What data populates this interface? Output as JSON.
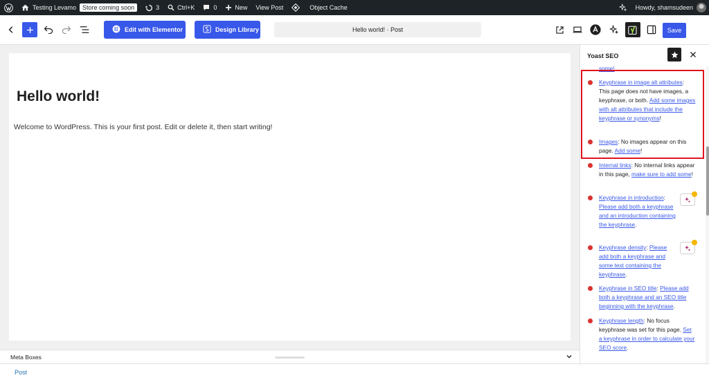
{
  "admin_bar": {
    "site_name": "Testing Levamo",
    "store_badge": "Store coming soon",
    "updates_count": "3",
    "shortcut": "Ctrl+K",
    "comments_count": "0",
    "new_label": "New",
    "view_post": "View Post",
    "object_cache": "Object Cache",
    "howdy": "Howdy, shamsudeen"
  },
  "toolbar": {
    "elementor_label": "Edit with Elementor",
    "design_library_label": "Design Library",
    "document_title": "Hello world! · Post",
    "save_label": "Save"
  },
  "post": {
    "title": "Hello world!",
    "paragraph": "Welcome to WordPress. This is your first post. Edit or delete it, then start writing!"
  },
  "meta_boxes_label": "Meta Boxes",
  "footer_breadcrumb": "Post",
  "sidebar": {
    "title": "Yoast SEO",
    "top_fragment": "some!",
    "items": [
      {
        "link": "Keyphrase in image alt attributes",
        "sep": ":",
        "text": " This page does not have images, a keyphrase, or both. ",
        "link2": "Add some images with alt attributes that include the keyphrase or synonyms",
        "end": "!"
      },
      {
        "link": "Images",
        "sep": ":",
        "text": " No images appear on this page. ",
        "link2": "Add some",
        "end": "!"
      },
      {
        "link": "Internal links",
        "sep": ":",
        "text": " No internal links appear in this page, ",
        "link2": "make sure to add some",
        "end": "!"
      },
      {
        "link": "Keyphrase in introduction",
        "sep": ":",
        "text": " ",
        "link2": "Please add both a keyphrase and an introduction containing the keyphrase",
        "end": "."
      },
      {
        "link": "Keyphrase density",
        "sep": ":",
        "text": " ",
        "link2": "Please add both a keyphrase and some text containing the keyphrase",
        "end": "."
      },
      {
        "link": "Keyphrase in SEO title",
        "sep": ":",
        "text": " ",
        "link2": "Please add both a keyphrase and an SEO title beginning with the keyphrase",
        "end": "."
      },
      {
        "link": "Keyphrase length",
        "sep": ":",
        "text": " No focus keyphrase was set for this page. ",
        "link2": "Set a keyphrase in order to calculate your SEO score",
        "end": "."
      }
    ]
  },
  "colors": {
    "accent": "#3858e9",
    "admin_bar": "#1d2327",
    "problem_dot": "#dc3232",
    "highlight": "#e0131e"
  },
  "icons": [
    "wordpress-logo-icon",
    "home-icon",
    "updates-icon",
    "search-icon",
    "comment-icon",
    "plus-icon",
    "diamond-icon",
    "sparkle-icon",
    "back-chevron-icon",
    "undo-icon",
    "redo-icon",
    "list-view-icon",
    "elementor-icon",
    "design-library-icon",
    "external-link-icon",
    "device-preview-icon",
    "astra-icon",
    "ai-sparkle-icon",
    "yoast-icon",
    "sidebar-toggle-icon",
    "star-icon",
    "close-icon",
    "chevron-down-icon",
    "lock-icon"
  ]
}
